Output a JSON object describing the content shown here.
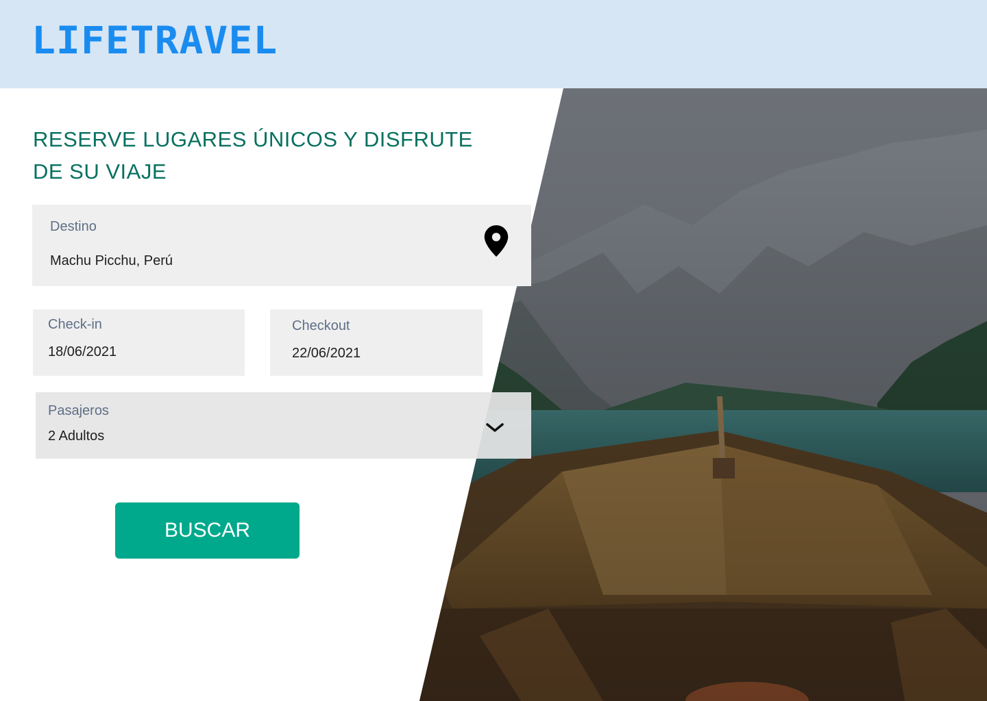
{
  "brand": {
    "logo_text": "LIFETRAVEL",
    "color": "#1a8cf0"
  },
  "header": {
    "background": "#d6e6f4"
  },
  "hero": {
    "headline": "RESERVE LUGARES ÚNICOS Y DISFRUTE DE SU VIAJE",
    "image": "mountain-lake-boat-photo"
  },
  "form": {
    "destino": {
      "label": "Destino",
      "value": "Machu Picchu, Perú",
      "icon": "location-pin-icon"
    },
    "checkin": {
      "label": "Check-in",
      "value": "18/06/2021"
    },
    "checkout": {
      "label": "Checkout",
      "value": "22/06/2021"
    },
    "pasajeros": {
      "label": "Pasajeros",
      "value": "2 Adultos",
      "icon": "chevron-down-icon"
    },
    "submit_label": "BUSCAR"
  },
  "colors": {
    "accent": "#00a98c",
    "headline": "#07705f",
    "label": "#5e6f86"
  }
}
